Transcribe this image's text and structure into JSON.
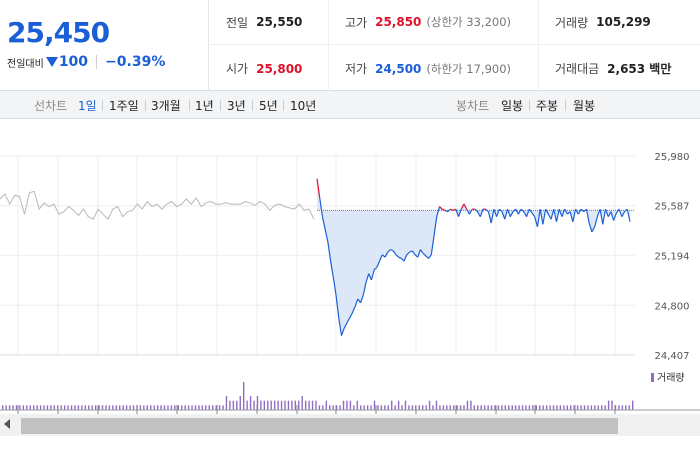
{
  "summary": {
    "price": "25,450",
    "change_label": "전일대비",
    "change": "100",
    "change_rate": "−0.39%"
  },
  "stats": {
    "prev_label": "전일",
    "prev": "25,550",
    "high_label": "고가",
    "high": "25,850",
    "upper_limit": "(상한가 33,200)",
    "volume_label": "거래량",
    "volume": "105,299",
    "open_label": "시가",
    "open": "25,800",
    "low_label": "저가",
    "low": "24,500",
    "lower_limit": "(하한가 17,900)",
    "amount_label": "거래대금",
    "amount": "2,653 백만"
  },
  "tabs": {
    "line_label": "선차트",
    "line": [
      "1일",
      "1주일",
      "3개월",
      "1년",
      "3년",
      "5년",
      "10년"
    ],
    "candle_label": "봉차트",
    "candle": [
      "일봉",
      "주봉",
      "월봉"
    ]
  },
  "colors": {
    "up": "#e0112b",
    "down": "#1b5fd6",
    "prev_day_line": "#b8b8b8",
    "fill": "#dce8f8",
    "volume": "#8e6cc2"
  },
  "chart_data": {
    "type": "line",
    "title": "",
    "xlabel": "",
    "ylabel": "",
    "y_ticks": [
      25980,
      25587,
      25194,
      24800,
      24407
    ],
    "ylim": [
      24407,
      25980
    ],
    "baseline": 25550,
    "grid": true,
    "legend": [
      "거래량"
    ],
    "series": [
      {
        "values": [
          25640,
          25680,
          25600,
          25670,
          25660,
          25520,
          25690,
          25700,
          25560,
          25610,
          25580,
          25600,
          25520,
          25540,
          25580,
          25550,
          25510,
          25560,
          25500,
          25480,
          25560,
          25520,
          25480,
          25560,
          25580,
          25500,
          25540,
          25550,
          25600,
          25560,
          25620,
          25580,
          25600,
          25560,
          25600,
          25620,
          25580,
          25600,
          25640,
          25600,
          25650,
          25580,
          25610,
          25620,
          25600,
          25600,
          25610,
          25600,
          25600,
          25600,
          25620,
          25610,
          25590,
          25620,
          25600,
          25550,
          25590,
          25600,
          25580,
          25570,
          25560,
          25600,
          25550,
          25560,
          25480
        ]
      },
      {
        "values": [
          25800,
          25650,
          25500,
          25400,
          25300,
          25150,
          25020,
          24880,
          24700,
          24560,
          24620,
          24660,
          24700,
          24740,
          24790,
          24850,
          24820,
          24880,
          24980,
          25050,
          25000,
          25080,
          25100,
          25150,
          25200,
          25180,
          25220,
          25240,
          25230,
          25200,
          25180,
          25170,
          25150,
          25200,
          25220,
          25230,
          25200,
          25180,
          25240,
          25210,
          25190,
          25170,
          25200,
          25350,
          25500,
          25580,
          25560,
          25550,
          25540,
          25560,
          25550,
          25560,
          25500,
          25560,
          25600,
          25560,
          25520,
          25560,
          25560,
          25540,
          25500,
          25560,
          25560,
          25540,
          25450,
          25560,
          25500,
          25560,
          25540,
          25480,
          25560,
          25500,
          25540,
          25560,
          25520,
          25560,
          25540,
          25500,
          25560,
          25530,
          25500,
          25420,
          25560,
          25440,
          25560,
          25520,
          25480,
          25560,
          25460,
          25560,
          25500,
          25560,
          25520,
          25540,
          25460,
          25560,
          25520,
          25560,
          25540,
          25560,
          25450,
          25380,
          25420,
          25500,
          25560,
          25440,
          25560,
          25500,
          25540,
          25470,
          25530,
          25560,
          25500,
          25540,
          25560,
          25460
        ]
      }
    ],
    "volume": [
      1,
      1,
      1,
      1,
      1,
      1,
      1,
      1,
      1,
      1,
      1,
      1,
      1,
      1,
      1,
      1,
      1,
      1,
      1,
      1,
      1,
      1,
      1,
      1,
      1,
      1,
      1,
      1,
      1,
      1,
      1,
      1,
      1,
      1,
      1,
      1,
      1,
      1,
      1,
      1,
      1,
      1,
      1,
      1,
      1,
      1,
      1,
      1,
      1,
      1,
      1,
      1,
      1,
      1,
      1,
      1,
      1,
      1,
      1,
      1,
      1,
      1,
      1,
      1,
      1,
      3,
      2,
      2,
      2,
      3,
      6,
      2,
      3,
      2,
      3,
      2,
      2,
      2,
      2,
      2,
      2,
      2,
      2,
      2,
      2,
      2,
      2,
      3,
      2,
      2,
      2,
      2,
      1,
      1,
      2,
      1,
      1,
      1,
      1,
      2,
      2,
      2,
      1,
      2,
      1,
      1,
      1,
      1,
      2,
      1,
      1,
      1,
      1,
      2,
      1,
      2,
      1,
      2,
      1,
      1,
      1,
      1,
      1,
      1,
      2,
      1,
      2,
      1,
      1,
      1,
      1,
      1,
      1,
      1,
      1,
      2,
      2,
      1,
      1,
      1,
      1,
      1,
      1,
      1,
      1,
      1,
      1,
      1,
      1,
      1,
      1,
      1,
      1,
      1,
      1,
      1,
      1,
      1,
      1,
      1,
      1,
      1,
      1,
      1,
      1,
      1,
      1,
      1,
      1,
      1,
      1,
      1,
      1,
      1,
      1,
      1,
      2,
      2,
      1,
      1,
      1,
      1,
      1,
      2
    ]
  }
}
